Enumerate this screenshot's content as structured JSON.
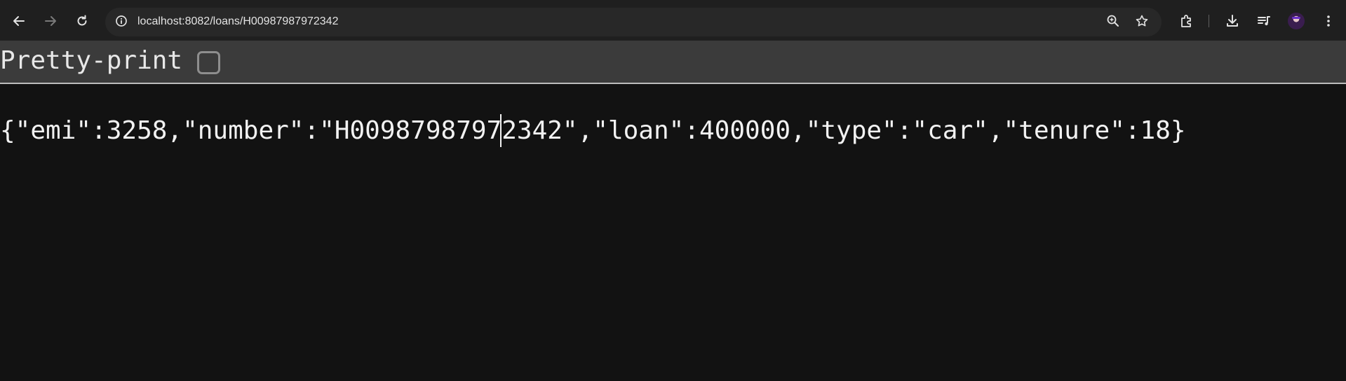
{
  "browser": {
    "url": "localhost:8082/loans/H00987987972342",
    "icons": {
      "back": "arrow-left-icon",
      "forward": "arrow-right-icon",
      "reload": "reload-icon",
      "site_info": "site-info-icon",
      "zoom": "zoom-icon",
      "bookmark": "star-icon",
      "extensions": "puzzle-icon",
      "download": "download-icon",
      "reading_list": "media-queue-icon",
      "profile": "avatar",
      "menu": "kebab-menu-icon"
    }
  },
  "viewer": {
    "pretty_print_label": "Pretty-print",
    "pretty_print_checked": false,
    "json_text": "{\"emi\":3258,\"number\":\"H00987987972342\",\"loan\":400000,\"type\":\"car\",\"tenure\":18}"
  },
  "colors": {
    "page_bg": "#121212",
    "toolbar_bg": "#1f1f1f",
    "omnibox_bg": "#282828",
    "pretty_bar_bg": "#3b3b3b",
    "text": "#f2f2f2"
  }
}
